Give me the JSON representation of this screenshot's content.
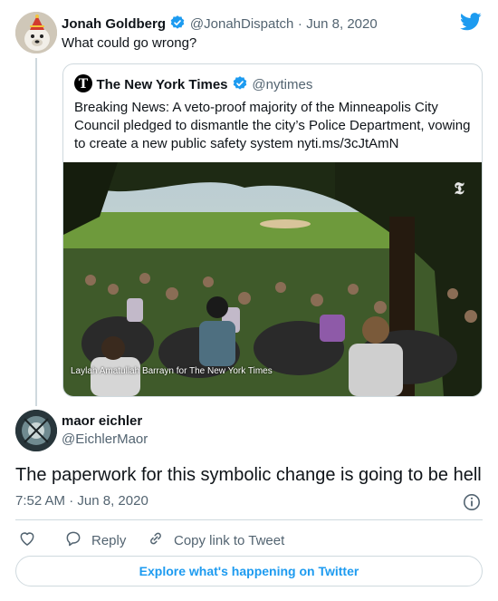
{
  "colors": {
    "accent": "#1d9bf0",
    "text": "#0f1419",
    "muted": "#536471",
    "border": "#cfd9de"
  },
  "tweet": {
    "author_name": "Jonah Goldberg",
    "author_handle": "@JonahDispatch",
    "separator": "·",
    "date": "Jun 8, 2020",
    "text": "What could go wrong?"
  },
  "quoted_tweet": {
    "author_name": "The New York Times",
    "author_handle": "@nytimes",
    "text": "Breaking News: A veto-proof majority of the Minneapolis City Council pledged to dismantle the city’s Police Department, vowing to create a new public safety system nyti.ms/3cJtAmN",
    "photo_caption": "Laylah Amatullah Barrayn for The New York Times"
  },
  "reply": {
    "author_name": "maor eichler",
    "author_handle": "@EichlerMaor",
    "text": "The paperwork for this symbolic change is going to be hell",
    "time": "7:52 AM",
    "separator": "·",
    "date": "Jun 8, 2020"
  },
  "actions": {
    "reply_label": "Reply",
    "copy_link_label": "Copy link to Tweet",
    "explore_label": "Explore what's happening on Twitter"
  },
  "icons": [
    "twitter-bird-icon",
    "verified-badge-icon",
    "nyt-logo-icon",
    "info-icon",
    "heart-icon",
    "reply-icon",
    "link-icon"
  ]
}
